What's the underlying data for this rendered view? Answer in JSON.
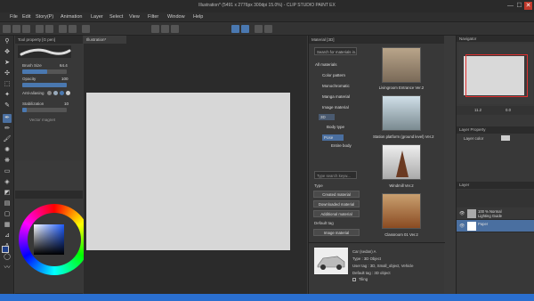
{
  "titlebar": {
    "title": "Illustration* (5491 x 2776px 300dpi 15.0%) - CLIP STUDIO PAINT EX",
    "minimize": "—",
    "maximize": "☐",
    "close": "✕"
  },
  "menu": [
    "File",
    "Edit",
    "Story(P)",
    "Animation",
    "Layer",
    "Select",
    "View",
    "Filter",
    "Window",
    "Help"
  ],
  "toolprop": {
    "header": "Tool property [G pen]",
    "brush_size_label": "Brush Size",
    "brush_size_value": "64.4",
    "brush_size_fraction": 0.55,
    "opacity_label": "Opacity",
    "opacity_value": "100",
    "opacity_fraction": 1.0,
    "antialias_label": "Anti-aliasing",
    "stabilization_label": "Stabilization",
    "stabilization_value": "10",
    "stabilization_fraction": 0.1,
    "vector_magnet_label": "Vector magnet"
  },
  "canvas": {
    "tab": "Illustration*"
  },
  "color_readout": "214  86  100",
  "material": {
    "header": "Material [3D]",
    "search_label": "Search for materials in...",
    "tree": [
      {
        "label": "All materials"
      },
      {
        "label": "Color pattern"
      },
      {
        "label": "Monochromatic"
      },
      {
        "label": "Manga material"
      },
      {
        "label": "Image material"
      },
      {
        "label": "3D"
      },
      {
        "label": "Body type"
      },
      {
        "label": "Pose"
      },
      {
        "label": "Entire body"
      }
    ],
    "tag_search_placeholder": "Type search keyw...",
    "type_label": "Type",
    "buttons": [
      "Created material",
      "Downloaded material",
      "Additional material"
    ],
    "default_tag_label": "Default tag",
    "image_material_button": "Image material",
    "items": [
      {
        "caption": "Livingroom Entrance Ver.2"
      },
      {
        "caption": "Station platform (ground level) Ver.2"
      },
      {
        "caption": "Windmill Ver.2"
      },
      {
        "caption": "Classroom 01 Ver.2"
      }
    ],
    "detail": {
      "name": "Car (sedan) A",
      "type": "Type : 3D Object",
      "user_tag": "User tag : 3D, Small_object, Vehicle",
      "default_tag": "Default tag : 3D object",
      "tiling": "Tiling"
    }
  },
  "navigator": {
    "header": "Navigator",
    "zoom": "11.2",
    "angle": "0.0"
  },
  "layer_property": {
    "header": "Layer Property",
    "layer_color_label": "Layer color"
  },
  "layers": {
    "header": "Layer",
    "rows": [
      {
        "name": "100 % Normal\nLighting Guide"
      },
      {
        "name": "Paper"
      }
    ]
  },
  "colors": {
    "accent": "#4a6fa0",
    "taskbar": "#2a6fd0",
    "canvas_page": "#d7d7d7",
    "nav_frame": "#e03030"
  }
}
